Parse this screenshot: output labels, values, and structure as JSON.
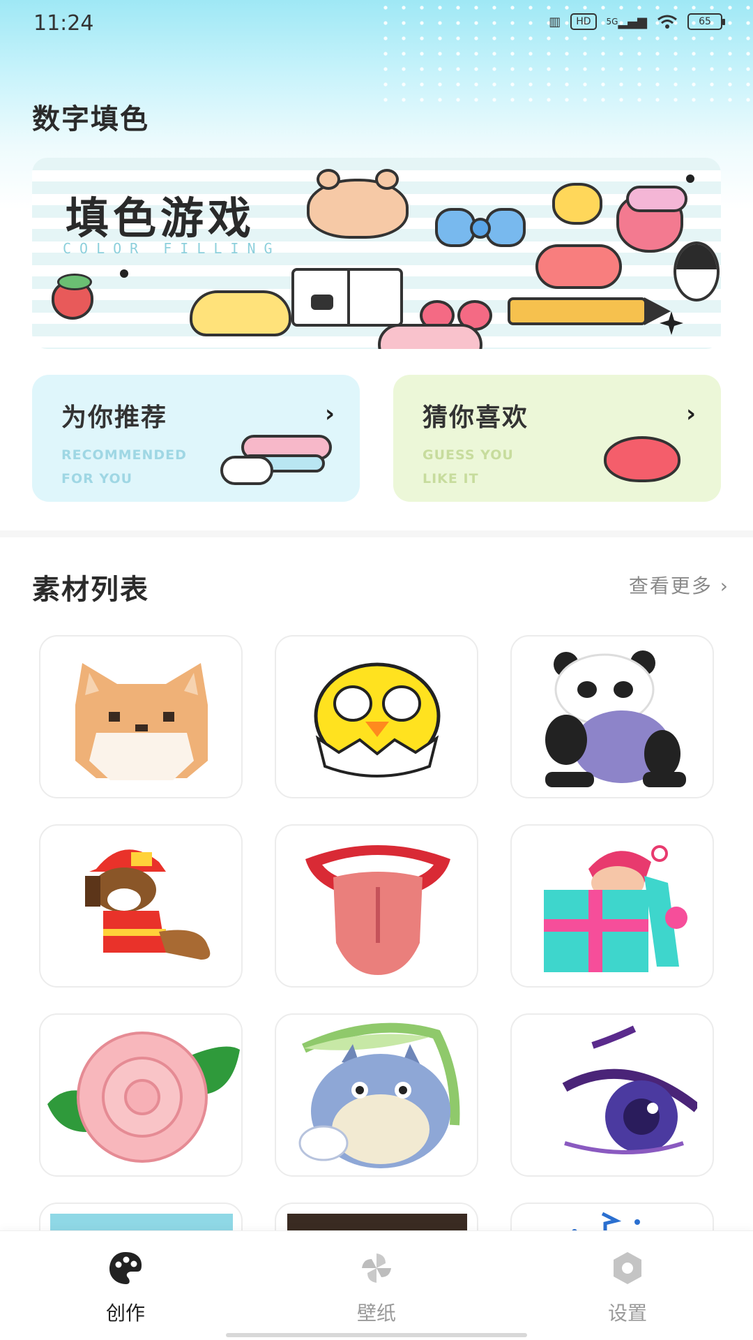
{
  "status_bar": {
    "time": "11:24",
    "network": "5G",
    "hd": "HD",
    "battery": "65"
  },
  "header": {
    "title": "数字填色"
  },
  "banner": {
    "title": "填色游戏",
    "subtitle": "COLOR FILLING"
  },
  "cards": [
    {
      "title": "为你推荐",
      "subtitle": "RECOMMENDED\nFOR YOU",
      "arrow": "›"
    },
    {
      "title": "猜你喜欢",
      "subtitle": "GUESS YOU\nLIKE IT",
      "arrow": "›"
    }
  ],
  "materials": {
    "title": "素材列表",
    "more": "查看更多 ›"
  },
  "nav": [
    {
      "label": "创作",
      "active": true
    },
    {
      "label": "壁纸",
      "active": false
    },
    {
      "label": "设置",
      "active": false
    }
  ]
}
